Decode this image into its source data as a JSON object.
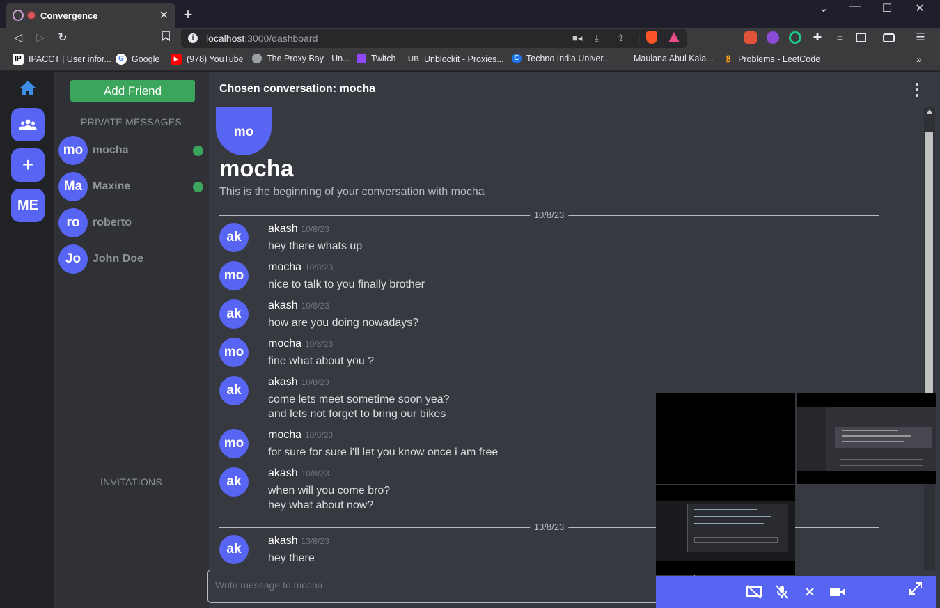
{
  "browser": {
    "tab_title": "Convergence",
    "url_host": "localhost",
    "url_path": ":3000/dashboard",
    "bookmarks": [
      {
        "label": "IPACCT | User infor...",
        "icon": "ipacct-icon",
        "color": "#ffffff"
      },
      {
        "label": "Google",
        "icon": "google-icon",
        "color": "#4285f4"
      },
      {
        "label": "(978) YouTube",
        "icon": "youtube-icon",
        "color": "#ff0000"
      },
      {
        "label": "The Proxy Bay - Un...",
        "icon": "globe-icon",
        "color": "#9aa0a6"
      },
      {
        "label": "Twitch",
        "icon": "twitch-icon",
        "color": "#9146ff"
      },
      {
        "label": "Unblockit - Proxies...",
        "icon": "unblockit-icon",
        "color": "#cccccc"
      },
      {
        "label": "Techno India Univer...",
        "icon": "techno-icon",
        "color": "#1a73e8"
      },
      {
        "label": "Maulana Abul Kala...",
        "icon": "blank-icon",
        "color": "#3b3b3e"
      },
      {
        "label": "Problems - LeetCode",
        "icon": "leetcode-icon",
        "color": "#ffa116"
      }
    ]
  },
  "rail": {
    "me_label": "ME"
  },
  "sidebar": {
    "add_friend": "Add Friend",
    "private_messages_label": "PRIVATE MESSAGES",
    "invitations_label": "INVITATIONS",
    "friends": [
      {
        "initials": "mo",
        "name": "mocha",
        "online": true
      },
      {
        "initials": "Ma",
        "name": "Maxine",
        "online": true
      },
      {
        "initials": "ro",
        "name": "roberto",
        "online": false
      },
      {
        "initials": "Jo",
        "name": "John Doe",
        "online": false
      }
    ]
  },
  "chat": {
    "header": "Chosen conversation: mocha",
    "intro_avatar": "mo",
    "intro_name": "mocha",
    "intro_text": "This is the beginning of your conversation with mocha",
    "dividers": [
      "10/8/23",
      "13/8/23"
    ],
    "messages": [
      {
        "initials": "ak",
        "author": "akash",
        "date": "10/8/23",
        "lines": [
          "hey there whats up"
        ]
      },
      {
        "initials": "mo",
        "author": "mocha",
        "date": "10/8/23",
        "lines": [
          "nice to talk to you finally brother"
        ]
      },
      {
        "initials": "ak",
        "author": "akash",
        "date": "10/8/23",
        "lines": [
          "how are you doing nowadays?"
        ]
      },
      {
        "initials": "mo",
        "author": "mocha",
        "date": "10/8/23",
        "lines": [
          "fine what about you ?"
        ]
      },
      {
        "initials": "ak",
        "author": "akash",
        "date": "10/8/23",
        "lines": [
          "come lets meet sometime soon yea?",
          "and lets not forget to bring our bikes"
        ]
      },
      {
        "initials": "mo",
        "author": "mocha",
        "date": "10/8/23",
        "lines": [
          "for sure for sure i'll let you know once i am free"
        ]
      },
      {
        "initials": "ak",
        "author": "akash",
        "date": "10/8/23",
        "lines": [
          "when will you come bro?",
          "hey what about now?"
        ]
      },
      {
        "initials": "ak",
        "author": "akash",
        "date": "13/8/23",
        "lines": [
          "hey there"
        ]
      }
    ],
    "composer_placeholder": "Write message to mocha"
  },
  "colors": {
    "accent": "#5865f2",
    "online": "#3ba55c",
    "add_friend": "#3ba55c"
  }
}
